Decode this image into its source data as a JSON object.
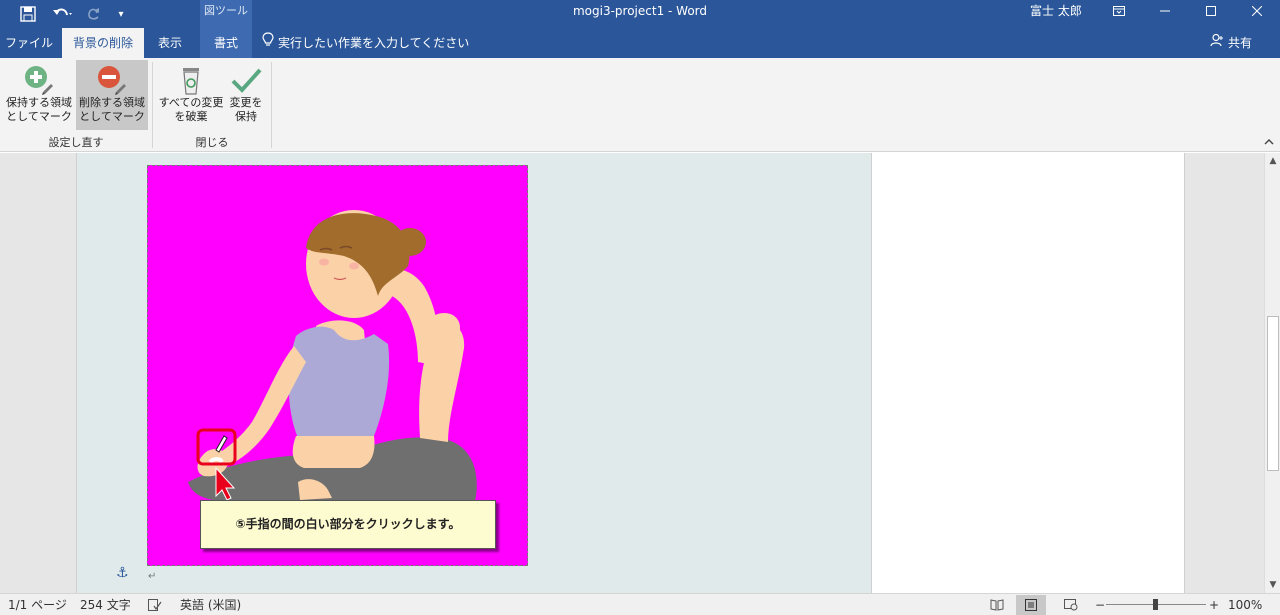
{
  "titlebar": {
    "context_group": "図ツール",
    "doc_title": "mogi3-project1  -  Word",
    "user": "富士 太郎",
    "save_icon": "save-icon",
    "undo_icon": "undo-icon",
    "redo_icon": "redo-icon"
  },
  "tabs": [
    {
      "label": "ファイル"
    },
    {
      "label": "背景の削除"
    },
    {
      "label": "表示"
    },
    {
      "label": "書式"
    }
  ],
  "tellme": "実行したい作業を入力してください",
  "share": "共有",
  "ribbon": {
    "groups": [
      {
        "label": "設定し直す"
      },
      {
        "label": "閉じる"
      }
    ],
    "buttons": [
      {
        "line1": "保持する領域",
        "line2": "としてマーク"
      },
      {
        "line1": "削除する領域",
        "line2": "としてマーク"
      },
      {
        "line1": "すべての変更",
        "line2": "を破棄"
      },
      {
        "line1": "変更を",
        "line2": "保持"
      }
    ]
  },
  "document": {
    "callout": "⑤手指の間の白い部分をクリックします。",
    "anchor_icon": "anchor-icon",
    "paragraph_mark": "↵"
  },
  "status": {
    "page": "1/1 ページ",
    "words": "254 文字",
    "language": "英語 (米国)",
    "zoom": "100%",
    "zoom_minus": "−",
    "zoom_plus": "+"
  },
  "colors": {
    "title_blue": "#2b579a",
    "image_background": "#ff00ff",
    "callout_bg": "#fdfbd0",
    "highlight_red": "#e8001c"
  }
}
